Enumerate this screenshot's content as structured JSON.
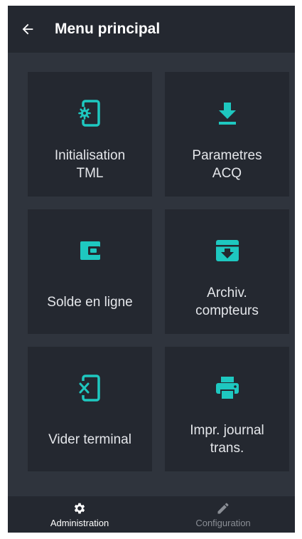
{
  "colors": {
    "accent": "#1ec8c0",
    "surface": "#2f343d",
    "tile": "#242830",
    "text": "#e4e6ea"
  },
  "appbar": {
    "title": "Menu principal",
    "back_icon": "arrow-left-icon"
  },
  "tiles": [
    {
      "label": "Initialisation\nTML",
      "icon": "phone-settings-icon"
    },
    {
      "label": "Parametres\nACQ",
      "icon": "download-icon"
    },
    {
      "label": "Solde en ligne",
      "icon": "wallet-icon"
    },
    {
      "label": "Archiv.\ncompteurs",
      "icon": "archive-icon"
    },
    {
      "label": "Vider terminal",
      "icon": "phone-erase-icon"
    },
    {
      "label": "Impr. journal\ntrans.",
      "icon": "printer-icon"
    }
  ],
  "bottom_nav": [
    {
      "label": "Administration",
      "icon": "gear-icon",
      "active": true
    },
    {
      "label": "Configuration",
      "icon": "pencil-icon",
      "active": false
    }
  ]
}
